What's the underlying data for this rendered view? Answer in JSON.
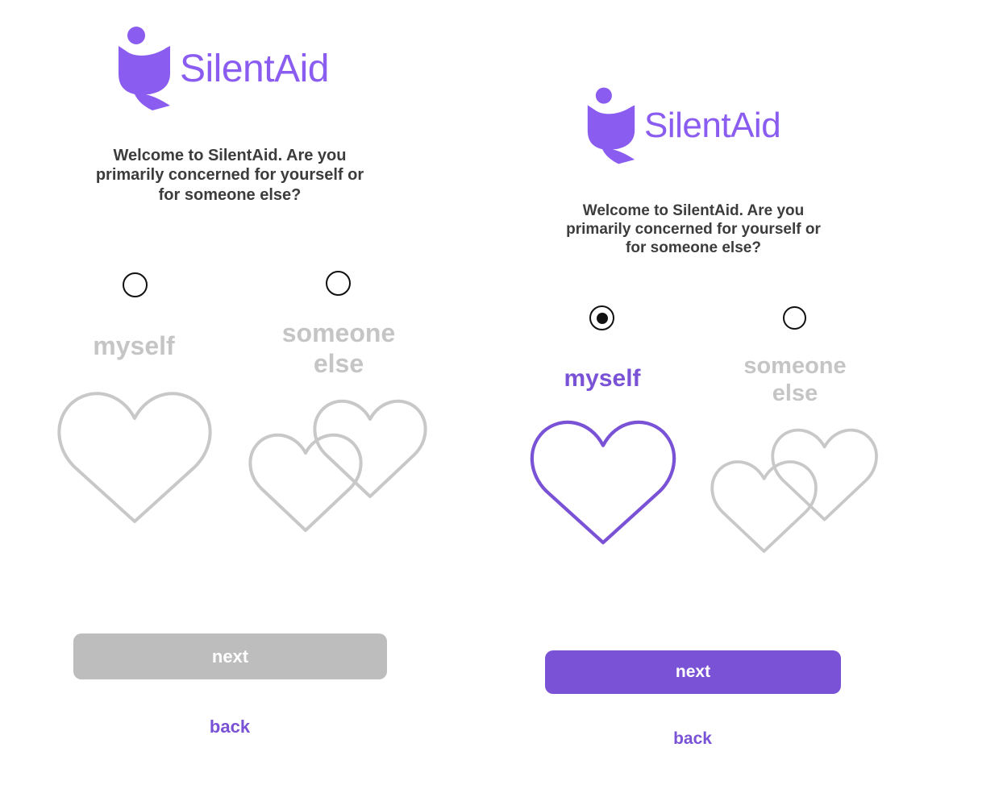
{
  "brand": {
    "name": "SilentAid",
    "color": "#8A5CF0",
    "accent": "#7A52D6"
  },
  "screens": [
    {
      "prompt": [
        "Welcome to SilentAid. Are you",
        "primarily concerned for yourself or",
        "for someone else?"
      ],
      "options": [
        {
          "label": "myself",
          "selected": false,
          "icon": "single-heart-icon"
        },
        {
          "label_lines": [
            "someone",
            "else"
          ],
          "selected": false,
          "icon": "double-heart-icon"
        }
      ],
      "next_label": "next",
      "next_state": "disabled",
      "back_label": "back"
    },
    {
      "prompt": [
        "Welcome to SilentAid. Are you",
        "primarily concerned for yourself or",
        "for someone else?"
      ],
      "options": [
        {
          "label": "myself",
          "selected": true,
          "icon": "single-heart-icon"
        },
        {
          "label_lines": [
            "someone",
            "else"
          ],
          "selected": false,
          "icon": "double-heart-icon"
        }
      ],
      "next_label": "next",
      "next_state": "enabled",
      "back_label": "back"
    }
  ]
}
